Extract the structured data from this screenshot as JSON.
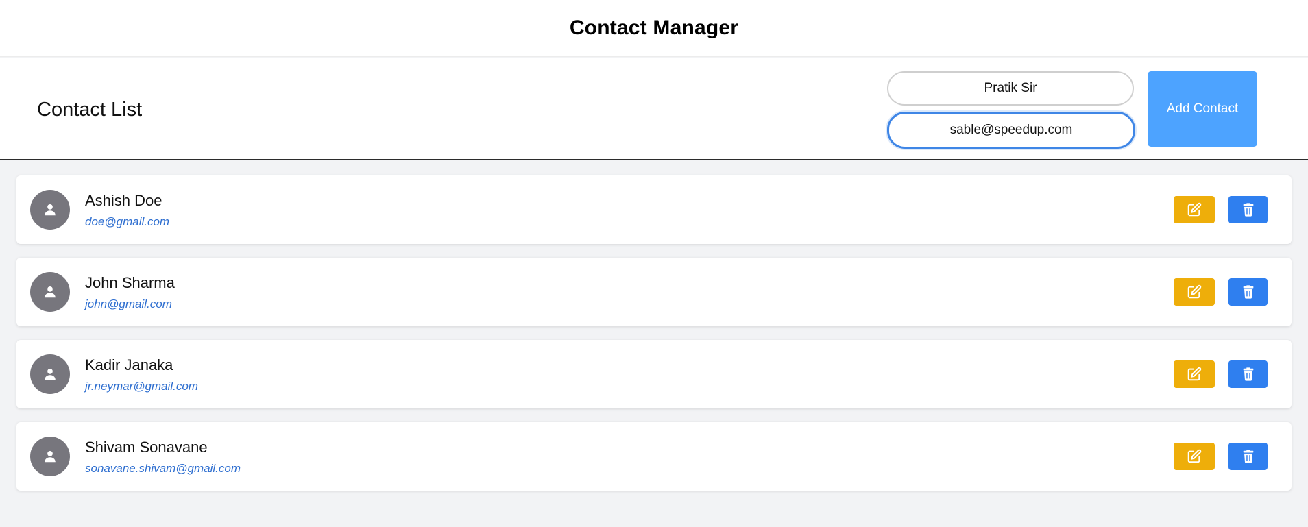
{
  "header": {
    "title": "Contact Manager"
  },
  "form": {
    "section_title": "Contact List",
    "name_value": "Pratik Sir",
    "email_value": "sable@speedup.com",
    "add_button_label": "Add Contact"
  },
  "contacts": [
    {
      "name": "Ashish Doe",
      "email": "doe@gmail.com"
    },
    {
      "name": "John Sharma",
      "email": "john@gmail.com"
    },
    {
      "name": "Kadir Janaka",
      "email": "jr.neymar@gmail.com"
    },
    {
      "name": "Shivam Sonavane",
      "email": "sonavane.shivam@gmail.com"
    }
  ],
  "icons": {
    "avatar": "user-icon",
    "edit": "pencil-square-icon",
    "delete": "trash-icon"
  },
  "colors": {
    "add_button": "#4da3ff",
    "edit_button": "#eeae0a",
    "delete_button": "#2f7fef",
    "avatar_bg": "#77767d",
    "email_text": "#2f6fd0"
  }
}
